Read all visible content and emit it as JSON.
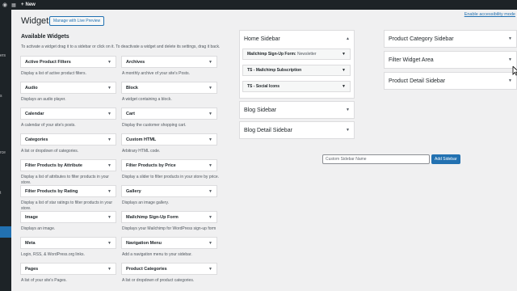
{
  "topbar": {
    "new_label": "New",
    "icons": [
      "wordpress-icon",
      "comment-icon",
      "plus-icon"
    ]
  },
  "sidebar": {
    "fragments": [
      "ers",
      "s",
      "rce",
      "t"
    ]
  },
  "header": {
    "title": "Widgets",
    "preview_label": "Manage with Live Preview",
    "accessibility_link": "Enable accessibility mode"
  },
  "available": {
    "title": "Available Widgets",
    "description": "To activate a widget drag it to a sidebar or click on it. To deactivate a widget and delete its settings, drag it back.",
    "widgets": [
      {
        "name": "Active Product Filters",
        "desc": "Display a list of active product filters."
      },
      {
        "name": "Archives",
        "desc": "A monthly archive of your site's Posts."
      },
      {
        "name": "Audio",
        "desc": "Displays an audio player."
      },
      {
        "name": "Block",
        "desc": "A widget containing a block."
      },
      {
        "name": "Calendar",
        "desc": "A calendar of your site's posts."
      },
      {
        "name": "Cart",
        "desc": "Display the customer shopping cart."
      },
      {
        "name": "Categories",
        "desc": "A list or dropdown of categories."
      },
      {
        "name": "Custom HTML",
        "desc": "Arbitrary HTML code."
      },
      {
        "name": "Filter Products by Attribute",
        "desc": "Display a list of attributes to filter products in your store."
      },
      {
        "name": "Filter Products by Price",
        "desc": "Display a slider to filter products in your store by price."
      },
      {
        "name": "Filter Products by Rating",
        "desc": "Display a list of star ratings to filter products in your store."
      },
      {
        "name": "Gallery",
        "desc": "Displays an image gallery."
      },
      {
        "name": "Image",
        "desc": "Displays an image."
      },
      {
        "name": "Mailchimp Sign-Up Form",
        "desc": "Displays your Mailchimp for WordPress sign-up form"
      },
      {
        "name": "Meta",
        "desc": "Login, RSS, & WordPress.org links."
      },
      {
        "name": "Navigation Menu",
        "desc": "Add a navigation menu to your sidebar."
      },
      {
        "name": "Pages",
        "desc": "A list of your site's Pages."
      },
      {
        "name": "Product Categories",
        "desc": "A list or dropdown of product categories."
      }
    ]
  },
  "sidebars_mid": {
    "home": {
      "title": "Home Sidebar",
      "widgets": [
        {
          "name": "Mailchimp Sign-Up Form:",
          "sub": "Newsletter"
        },
        {
          "name": "TS - Mailchimp Subscription",
          "sub": ""
        },
        {
          "name": "TS - Social Icons",
          "sub": ""
        }
      ]
    },
    "blog": {
      "title": "Blog Sidebar"
    },
    "blog_detail": {
      "title": "Blog Detail Sidebar"
    }
  },
  "sidebars_right": {
    "product_category": {
      "title": "Product Category Sidebar"
    },
    "filter": {
      "title": "Filter Widget Area"
    },
    "product_detail": {
      "title": "Product Detail Sidebar"
    }
  },
  "custom_sidebar": {
    "placeholder": "Custom Sidebar Name",
    "button_label": "Add Sidebar"
  },
  "colors": {
    "accent": "#2271b1",
    "admin_bar": "#1d2327",
    "background": "#f0f0f1"
  }
}
